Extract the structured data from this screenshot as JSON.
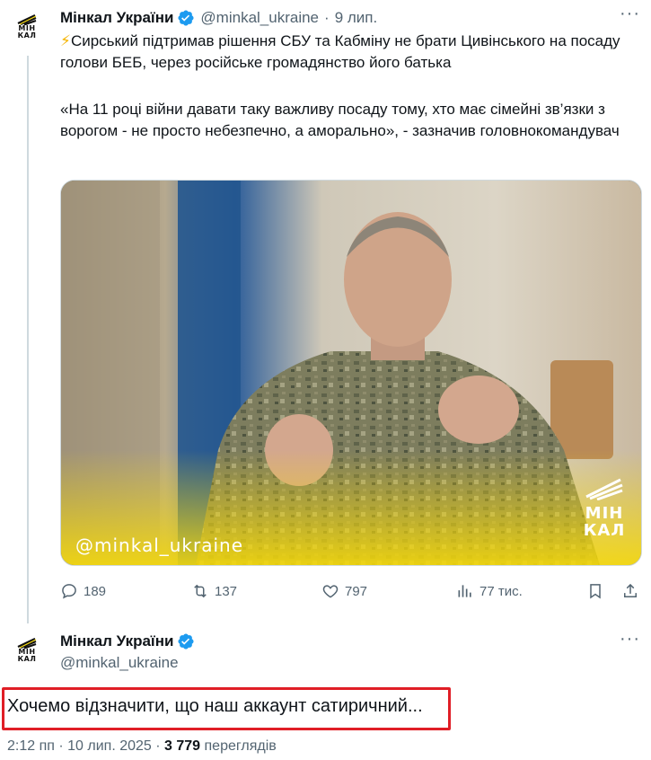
{
  "tweet": {
    "author_name": "Мінкал України",
    "handle": "@minkal_ukraine",
    "separator": "·",
    "date": "9 лип.",
    "emoji": "⚡",
    "line1": "Сирський підтримав рішення СБУ та Кабміну не брати Цивінського на посаду голови БЕБ, через російське громадянство його батька",
    "quote": "«На 11 році війни давати таку важливу посаду тому, хто має сімейні зв’язки з ворогом - не просто небезпечно, а аморально», - зазначив головнокомандувач",
    "image_watermark": "@minkal_ukraine",
    "image_logo_line1": "МІН",
    "image_logo_line2": "КАЛ",
    "replies": "189",
    "retweets": "137",
    "likes": "797",
    "views": "77 тис."
  },
  "reply": {
    "author_name": "Мінкал України",
    "handle": "@minkal_ukraine",
    "text": "Хочемо відзначити, що наш аккаунт сатиричний...",
    "time": "2:12 пп · 10 лип. 2025 · ",
    "view_count": "3 779",
    "views_label": " переглядів"
  },
  "avatar": {
    "line1": "МІН",
    "line2": "КАЛ"
  },
  "colors": {
    "accent": "#1d9bf0",
    "highlight": "#e01e26",
    "muted": "#536471",
    "brand_yellow": "#f5d90a"
  },
  "icons": [
    "avatar-logo-icon",
    "verified-badge-icon",
    "more-icon",
    "reply-icon",
    "retweet-icon",
    "like-icon",
    "views-icon",
    "bookmark-icon",
    "share-icon"
  ]
}
